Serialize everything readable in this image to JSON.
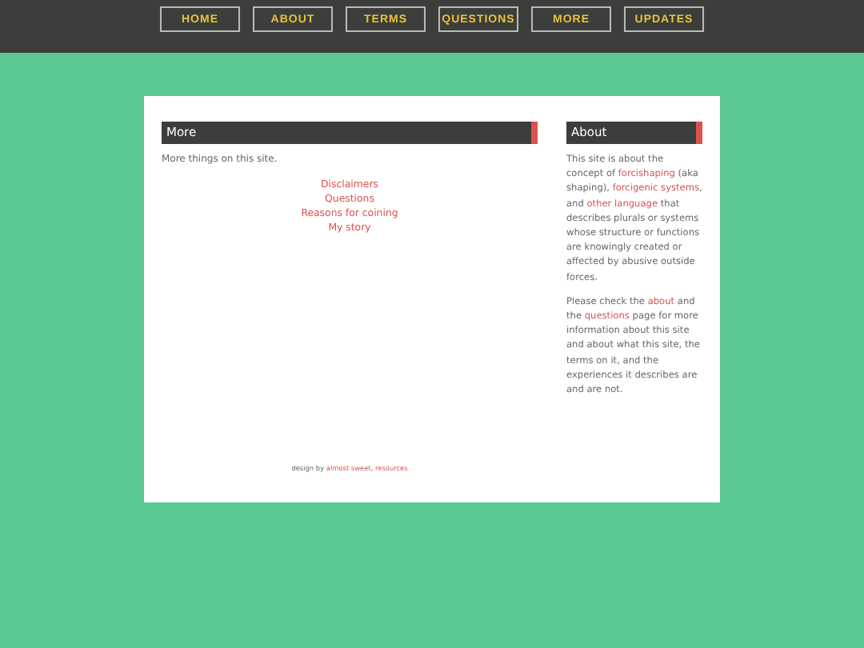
{
  "nav": [
    {
      "label": "HOME"
    },
    {
      "label": "ABOUT"
    },
    {
      "label": "TERMS"
    },
    {
      "label": "QUESTIONS"
    },
    {
      "label": "MORE"
    },
    {
      "label": "UPDATES"
    }
  ],
  "main": {
    "heading": "More",
    "intro": "More things on this site.",
    "links": [
      "Disclaimers",
      "Questions",
      "Reasons for coining",
      "My story"
    ]
  },
  "footer": [
    {
      "kind": "text",
      "text": "design by "
    },
    {
      "kind": "link",
      "text": "almost sweet"
    },
    {
      "kind": "text",
      "text": ", "
    },
    {
      "kind": "link",
      "text": "resources"
    }
  ],
  "sidebar": {
    "heading": "About",
    "paragraphs": [
      [
        {
          "kind": "text",
          "text": "This site is about the concept of "
        },
        {
          "kind": "link",
          "text": "forcishaping"
        },
        {
          "kind": "text",
          "text": " (aka shaping), "
        },
        {
          "kind": "link",
          "text": "forcigenic systems"
        },
        {
          "kind": "text",
          "text": ", and "
        },
        {
          "kind": "link",
          "text": "other language"
        },
        {
          "kind": "text",
          "text": " that describes plurals or systems whose structure or functions are knowingly created or affected by abusive outside forces."
        }
      ],
      [
        {
          "kind": "text",
          "text": "Please check the "
        },
        {
          "kind": "link",
          "text": "about"
        },
        {
          "kind": "text",
          "text": " and the "
        },
        {
          "kind": "link",
          "text": "questions"
        },
        {
          "kind": "text",
          "text": " page for more information about this site and about what this site, the terms on it, and the experiences it describes are and are not."
        }
      ]
    ]
  }
}
